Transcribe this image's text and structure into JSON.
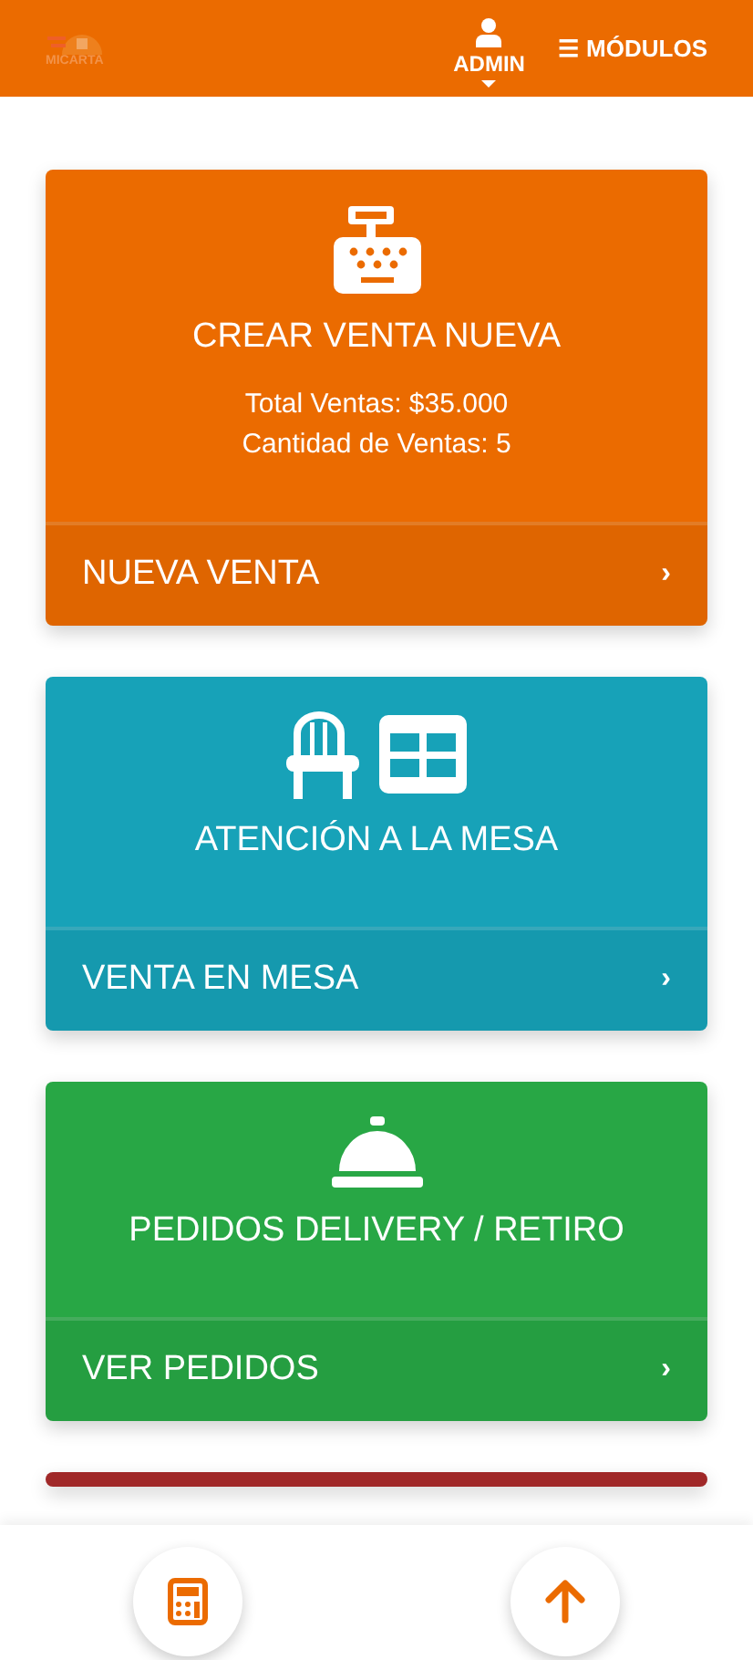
{
  "header": {
    "logo_text": "MICARTA",
    "user": {
      "label": "ADMIN"
    },
    "menu": {
      "icon": "☰",
      "label": "MÓDULOS"
    }
  },
  "cards": [
    {
      "kind": "register",
      "color": "#eb6b00",
      "title": "CREAR VENTA NUEVA",
      "stats": [
        "Total Ventas: $35.000",
        "Cantidad de Ventas: 5"
      ],
      "action": {
        "label": "NUEVA VENTA",
        "chevron": "›"
      }
    },
    {
      "kind": "table",
      "color": "#17a2b8",
      "title": "ATENCIÓN A LA MESA",
      "action": {
        "label": "VENTA EN MESA",
        "chevron": "›"
      }
    },
    {
      "kind": "bell",
      "color": "#28a745",
      "title": "PEDIDOS DELIVERY / RETIRO",
      "action": {
        "label": "VER PEDIDOS",
        "chevron": "›"
      }
    },
    {
      "color": "#a02828"
    }
  ],
  "bottom_bar": {
    "buttons": [
      {
        "kind": "calculator"
      },
      {
        "kind": "scroll-up"
      }
    ]
  }
}
